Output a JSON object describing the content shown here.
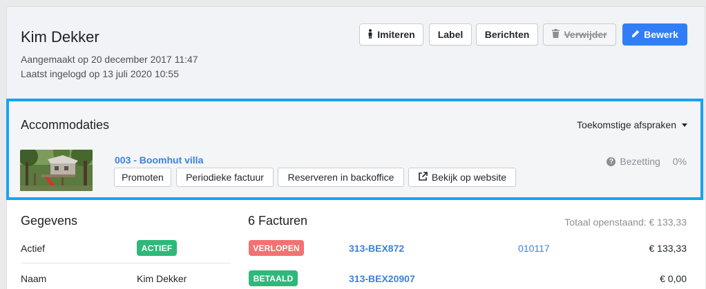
{
  "header": {
    "name": "Kim Dekker",
    "created": "Aangemaakt op 20 december 2017 11:47",
    "last_login": "Laatst ingelogd op 13 juli 2020 10:55",
    "buttons": {
      "imiteren": "Imiteren",
      "label": "Label",
      "berichten": "Berichten",
      "verwijder": "Verwijder",
      "bewerk": "Bewerk"
    }
  },
  "accommodaties": {
    "title": "Accommodaties",
    "filter": "Toekomstige afspraken",
    "property": {
      "name": "003 - Boomhut villa",
      "actions": {
        "promoten": "Promoten",
        "periodiek": "Periodieke factuur",
        "reserveren": "Reserveren in backoffice",
        "bekijk": "Bekijk op website"
      },
      "occupancy_label": "Bezetting",
      "occupancy_value": "0%"
    }
  },
  "gegevens": {
    "title": "Gegevens",
    "rows": [
      {
        "label": "Actief",
        "badge": "ACTIEF"
      },
      {
        "label": "Naam",
        "value": "Kim Dekker"
      }
    ]
  },
  "facturen": {
    "title": "6 Facturen",
    "total": "Totaal openstaand: € 133,33",
    "rows": [
      {
        "status": "VERLOPEN",
        "number": "313-BEX872",
        "ref": "010117",
        "amount": "€ 133,33"
      },
      {
        "status": "BETAALD",
        "number": "313-BEX20907",
        "ref": "",
        "amount": "€ 0,00"
      }
    ]
  },
  "colors": {
    "primary": "#2f7ef5",
    "highlight_border": "#16a3f2",
    "link": "#3a82de",
    "success": "#2eb87a",
    "danger": "#f47171"
  },
  "icons": {
    "imiteren": "person-icon",
    "verwijder": "trash-icon",
    "bewerk": "pencil-icon",
    "dropdown": "chevron-down-icon",
    "bezetting": "question-circle-icon",
    "bekijk": "external-link-icon"
  }
}
